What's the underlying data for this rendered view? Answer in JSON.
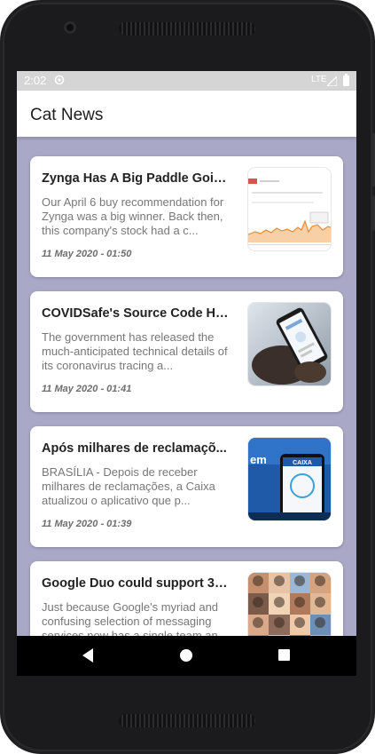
{
  "status_bar": {
    "time": "2:02",
    "network": "LTE",
    "icons": [
      "sync-icon",
      "signal-icon",
      "battery-icon"
    ]
  },
  "app_bar": {
    "title": "Cat News"
  },
  "articles": [
    {
      "headline": "Zynga Has A Big Paddle Goin...",
      "summary": "Our April 6 buy recommendation for Zynga was a big winner. Back then, this company's stock had a c...",
      "date": "11 May 2020 - 01:50",
      "thumbnail": "stock-chart-thumbnail"
    },
    {
      "headline": "COVIDSafe's Source Code Ha...",
      "summary": "The government has released the much-anticipated technical details of its coronavirus tracing a...",
      "date": "11 May 2020 - 01:41",
      "thumbnail": "phone-in-hand-thumbnail"
    },
    {
      "headline": "Após milhares de reclamaçõ...",
      "summary": "BRASÍLIA - Depois de receber milhares de reclamações, a Caixa atualizou o aplicativo que p...",
      "date": "11 May 2020 - 01:39",
      "thumbnail": "caixa-app-thumbnail",
      "thumbnail_text": {
        "brand": "CAIXA",
        "banner_fragment": "em"
      }
    },
    {
      "headline": "Google Duo could support 32...",
      "summary": "Just because Google's myriad and confusing selection of messaging services now has a single team an...",
      "date": "",
      "thumbnail": "video-call-grid-thumbnail"
    }
  ],
  "nav_bar": {
    "icons": [
      "back-icon",
      "home-icon",
      "recents-icon"
    ]
  },
  "colors": {
    "list_background": "#a9a8c7",
    "status_bar": "#d5d5d5",
    "app_bar": "#ffffff",
    "nav_bar": "#000000"
  }
}
